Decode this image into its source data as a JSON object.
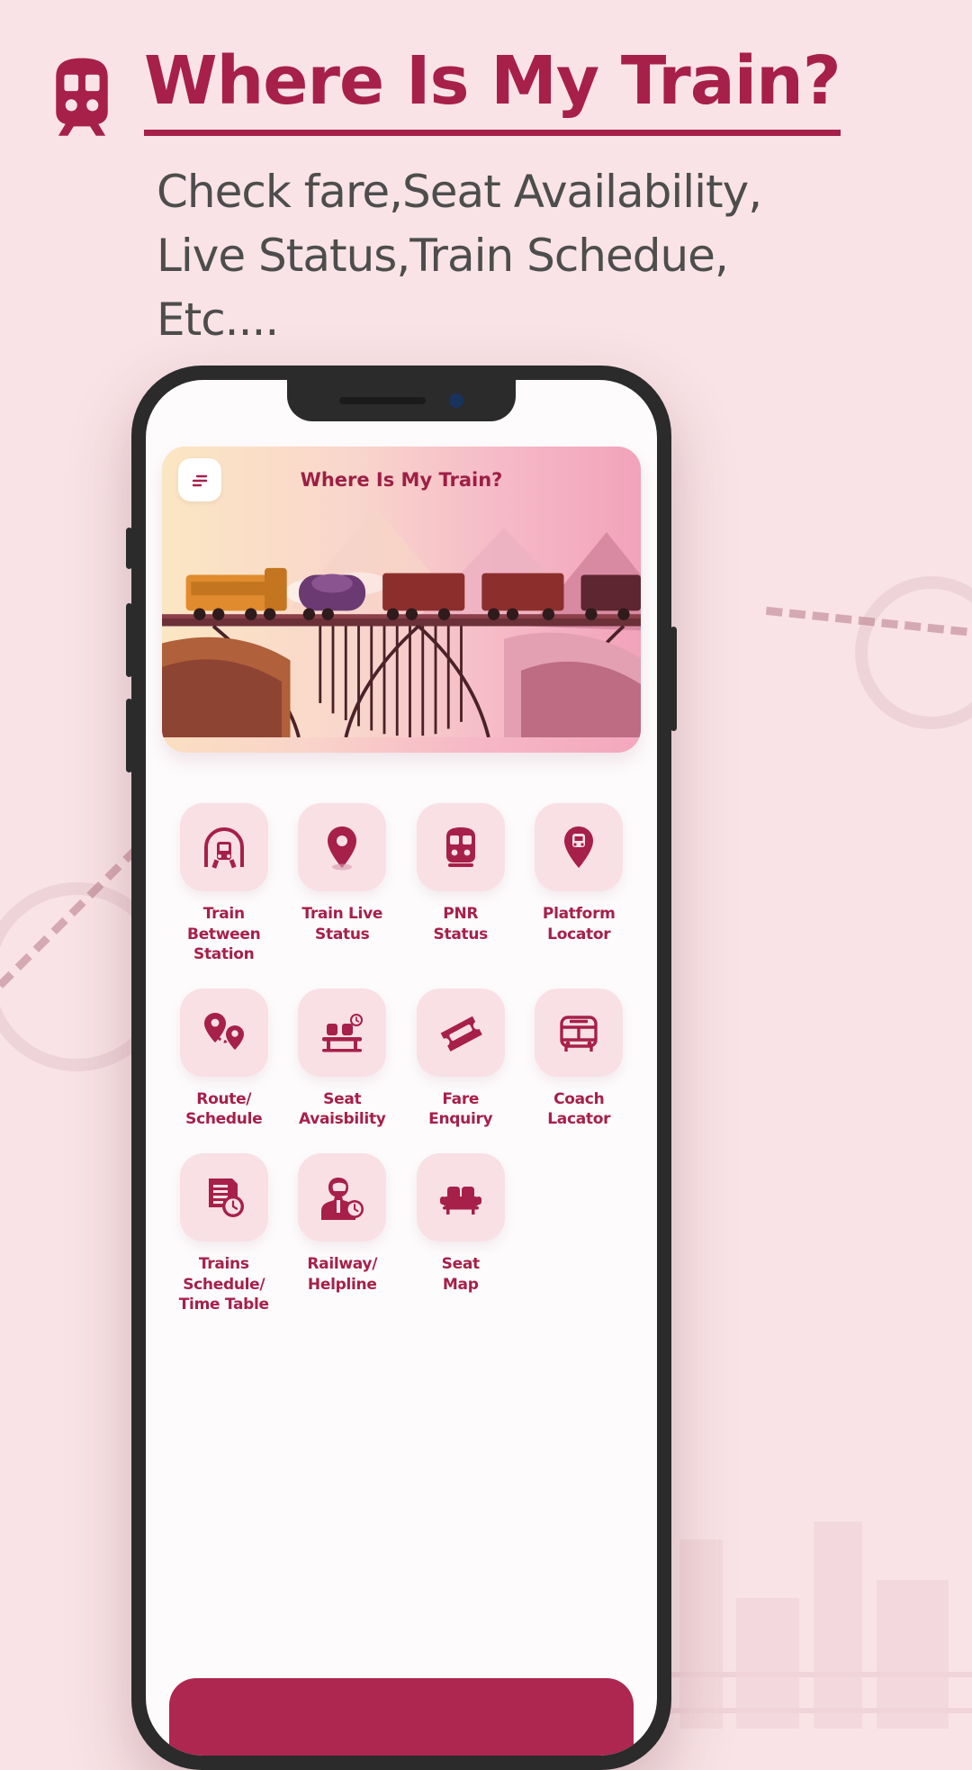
{
  "theme": {
    "page_bg": "#f9e3e6",
    "brand": "#a6204a",
    "accent_dark": "#ad2750",
    "tile_bg": "#f8e0e5",
    "subtitle_color": "#4d4d4d"
  },
  "promo": {
    "brand_icon": "train-front-icon",
    "title": "Where Is My Train?",
    "subtitle_lines": [
      "Check fare,Seat Availability,",
      "Live Status,Train Schedue,",
      "Etc...."
    ]
  },
  "phone": {
    "notch": {
      "speaker": "speaker-grille",
      "camera": "front-camera"
    },
    "side_buttons": [
      "silent-switch",
      "volume-up-button",
      "volume-down-button",
      "power-button"
    ]
  },
  "app": {
    "banner": {
      "menu_icon": "hamburger-menu-icon",
      "title": "Where Is My Train?",
      "art": "train-on-bridge-illustration"
    },
    "grid": [
      {
        "icon": "train-tunnel-icon",
        "label": "Train Between\nStation"
      },
      {
        "icon": "location-pin-icon",
        "label": "Train Live\nStatus"
      },
      {
        "icon": "train-front-icon",
        "label": "PNR\nStatus"
      },
      {
        "icon": "platform-pin-icon",
        "label": "Platform\nLocator"
      },
      {
        "icon": "route-pins-icon",
        "label": "Route/\nSchedule"
      },
      {
        "icon": "seats-table-icon",
        "label": "Seat\nAvaisbility"
      },
      {
        "icon": "ticket-icon",
        "label": "Fare\nEnquiry"
      },
      {
        "icon": "coach-bus-icon",
        "label": "Coach\nLacator"
      },
      {
        "icon": "schedule-clock-icon",
        "label": "Trains Schedule/\nTime Table"
      },
      {
        "icon": "support-agent-icon",
        "label": "Railway/\nHelpline"
      },
      {
        "icon": "sofa-seat-icon",
        "label": "Seat\nMap"
      }
    ],
    "bottom_bar": "bottom-action-bar"
  }
}
